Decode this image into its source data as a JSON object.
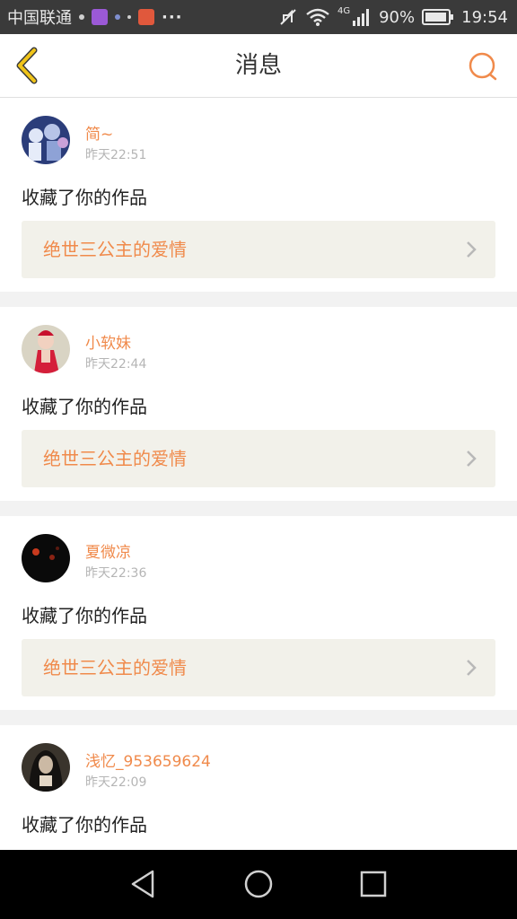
{
  "status_bar": {
    "carrier": "中国联通",
    "network": "4G",
    "battery": "90%",
    "time": "19:54",
    "more": "···"
  },
  "header": {
    "title": "消息",
    "back_icon": "chevron-left-icon",
    "search_icon": "search-icon"
  },
  "colors": {
    "accent": "#f08a4b",
    "back": "#e8b400",
    "card_link_bg": "#f2f1ea"
  },
  "messages": [
    {
      "username": "简~",
      "time": "昨天22:51",
      "action": "收藏了你的作品",
      "work_title": "绝世三公主的爱情"
    },
    {
      "username": "小软妹",
      "time": "昨天22:44",
      "action": "收藏了你的作品",
      "work_title": "绝世三公主的爱情"
    },
    {
      "username": "夏微凉",
      "time": "昨天22:36",
      "action": "收藏了你的作品",
      "work_title": "绝世三公主的爱情"
    },
    {
      "username": "浅忆_953659624",
      "time": "昨天22:09",
      "action": "收藏了你的作品",
      "work_title": ""
    }
  ],
  "nav": {
    "back_icon": "triangle-back-icon",
    "home_icon": "circle-home-icon",
    "recents_icon": "square-recents-icon"
  }
}
